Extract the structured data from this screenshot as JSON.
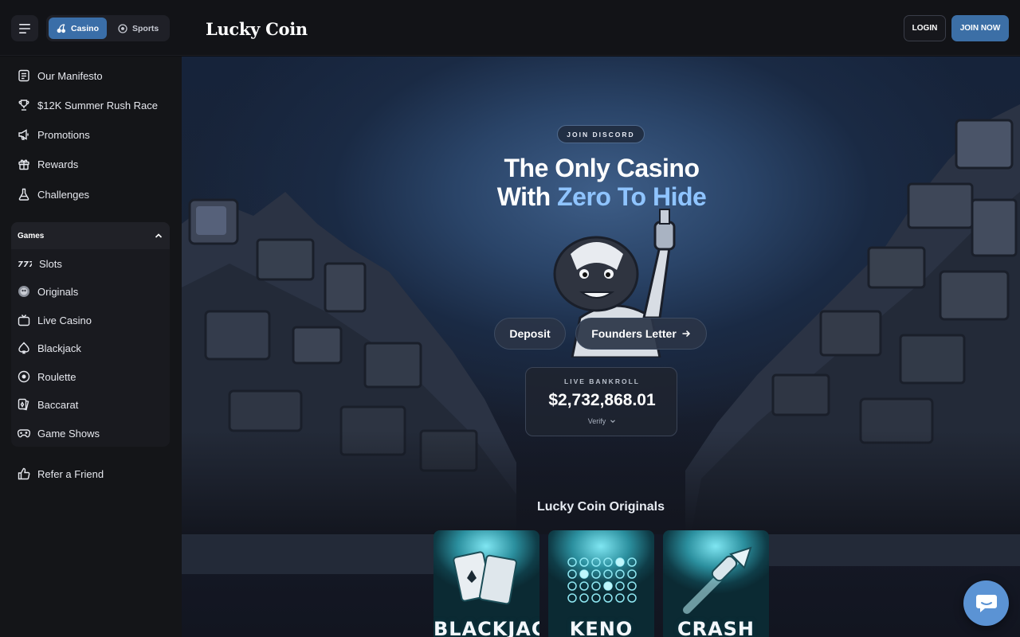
{
  "topbar": {
    "mode_tabs": [
      {
        "label": "Casino",
        "active": true
      },
      {
        "label": "Sports",
        "active": false
      }
    ],
    "logo": "Lucky Coin",
    "login_label": "LOGIN",
    "join_label": "JOIN NOW"
  },
  "sidebar": {
    "top_items": [
      {
        "label": "Our Manifesto",
        "icon": "manifesto-icon"
      },
      {
        "label": "$12K Summer Rush Race",
        "icon": "trophy-icon"
      },
      {
        "label": "Promotions",
        "icon": "megaphone-icon"
      },
      {
        "label": "Rewards",
        "icon": "gift-icon"
      },
      {
        "label": "Challenges",
        "icon": "flask-icon"
      }
    ],
    "games_header": "Games",
    "games": [
      {
        "label": "Slots",
        "icon": "slots-777-icon"
      },
      {
        "label": "Originals",
        "icon": "originals-icon"
      },
      {
        "label": "Live Casino",
        "icon": "tv-icon"
      },
      {
        "label": "Blackjack",
        "icon": "spade-icon"
      },
      {
        "label": "Roulette",
        "icon": "roulette-icon"
      },
      {
        "label": "Baccarat",
        "icon": "cards-icon"
      },
      {
        "label": "Game Shows",
        "icon": "gamepad-icon"
      }
    ],
    "refer_label": "Refer a Friend"
  },
  "hero": {
    "discord_label": "JOIN DISCORD",
    "title_line1": "The Only Casino",
    "title_line2_prefix": "With ",
    "title_line2_accent": "Zero To Hide",
    "deposit_label": "Deposit",
    "founders_label": "Founders Letter"
  },
  "bankroll": {
    "label": "LIVE BANKROLL",
    "value": "$2,732,868.01",
    "verify_label": "Verify"
  },
  "originals": {
    "title": "Lucky Coin Originals",
    "cards": [
      {
        "label": "BLACKJACK"
      },
      {
        "label": "KENO"
      },
      {
        "label": "CRASH"
      }
    ]
  },
  "colors": {
    "accent": "#3c6fa6",
    "hero_accent_text": "#8fc4ff",
    "chat_button": "#5b93d4"
  }
}
